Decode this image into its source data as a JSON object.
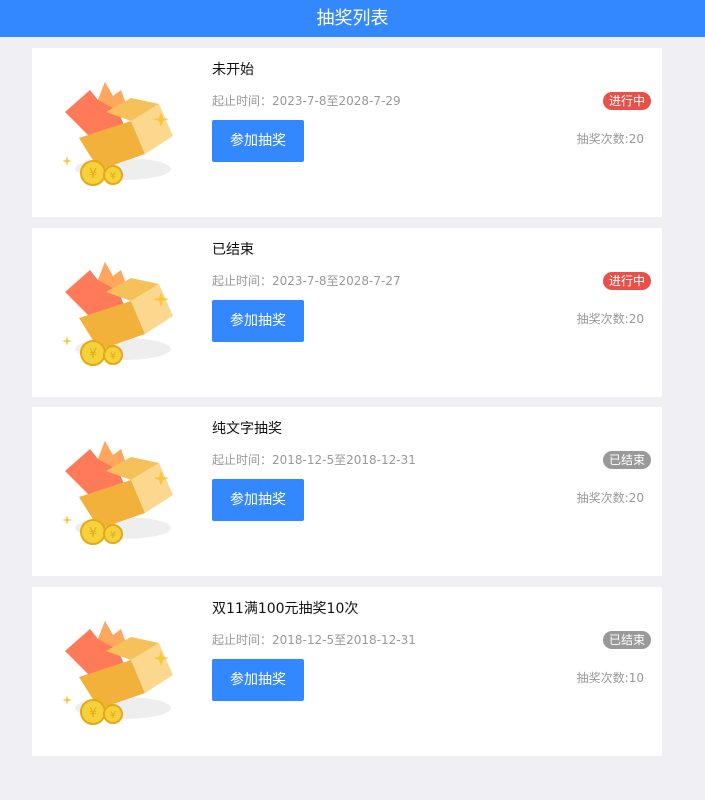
{
  "header": {
    "title": "抽奖列表"
  },
  "items": [
    {
      "title": "未开始",
      "time_label": "起止时间：",
      "time_range": "2023-7-8至2028-7-29",
      "button_label": "参加抽奖",
      "status": "进行中",
      "status_type": "ongoing",
      "count_label": "抽奖次数:",
      "count_value": "20"
    },
    {
      "title": "已结束",
      "time_label": "起止时间：",
      "time_range": "2023-7-8至2028-7-27",
      "button_label": "参加抽奖",
      "status": "进行中",
      "status_type": "ongoing",
      "count_label": "抽奖次数:",
      "count_value": "20"
    },
    {
      "title": "纯文字抽奖",
      "time_label": "起止时间：",
      "time_range": "2018-12-5至2018-12-31",
      "button_label": "参加抽奖",
      "status": "已结束",
      "status_type": "ended",
      "count_label": "抽奖次数:",
      "count_value": "20"
    },
    {
      "title": "双11满100元抽奖10次",
      "time_label": "起止时间：",
      "time_range": "2018-12-5至2018-12-31",
      "button_label": "参加抽奖",
      "status": "已结束",
      "status_type": "ended",
      "count_label": "抽奖次数:",
      "count_value": "10"
    }
  ],
  "icons": {
    "card_image": "gift-box-icon"
  },
  "colors": {
    "primary": "#3388ff",
    "ongoing_badge": "#e9504a",
    "ended_badge": "#999999",
    "background": "#efeff4"
  }
}
